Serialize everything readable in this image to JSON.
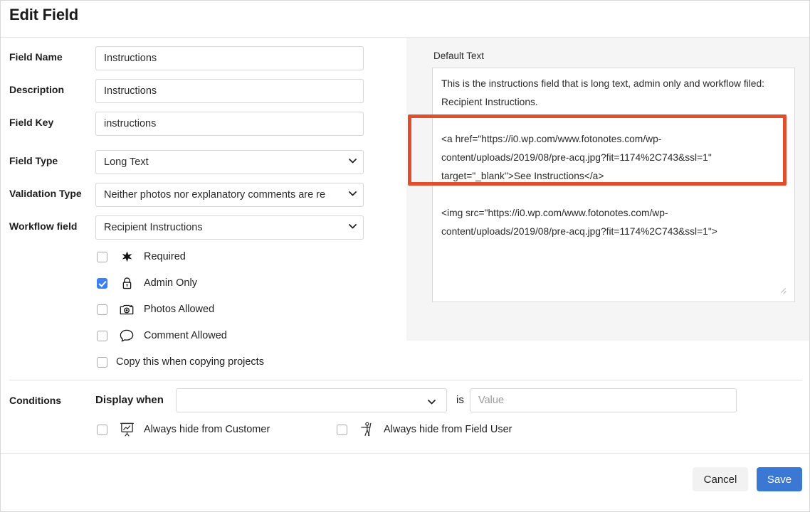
{
  "header": {
    "title": "Edit Field"
  },
  "form": {
    "rows": [
      {
        "label": "Field Name",
        "value": "Instructions",
        "control": "text"
      },
      {
        "label": "Description",
        "value": "Instructions",
        "control": "text"
      },
      {
        "label": "Field Key",
        "value": "instructions",
        "control": "text"
      },
      {
        "label": "Field Type",
        "value": "Long Text",
        "control": "select"
      },
      {
        "label": "Validation Type",
        "value": "Neither photos nor explanatory comments are re",
        "control": "select"
      },
      {
        "label": "Workflow field",
        "value": "Recipient Instructions",
        "control": "select"
      }
    ],
    "checkboxes": [
      {
        "label": "Required",
        "icon": "star-icon",
        "checked": false
      },
      {
        "label": "Admin Only",
        "icon": "lock-icon",
        "checked": true
      },
      {
        "label": "Photos Allowed",
        "icon": "camera-icon",
        "checked": false
      },
      {
        "label": "Comment Allowed",
        "icon": "comment-icon",
        "checked": false
      },
      {
        "label": "Copy this when copying projects",
        "icon": "none",
        "checked": false
      }
    ]
  },
  "default_text": {
    "label": "Default Text",
    "value": "This is the instructions field that is long text, admin only and workflow filed: Recipient Instructions.\n\n<a href=\"https://i0.wp.com/www.fotonotes.com/wp-content/uploads/2019/08/pre-acq.jpg?fit=1174%2C743&ssl=1\" target=\"_blank\">See Instructions</a>\n\n<img src=\"https://i0.wp.com/www.fotonotes.com/wp-content/uploads/2019/08/pre-acq.jpg?fit=1174%2C743&ssl=1\">"
  },
  "annotation": {
    "color": "#e04f2c"
  },
  "conditions": {
    "label": "Conditions",
    "display_when_label": "Display when",
    "display_when_value": "",
    "is_label": "is",
    "value_placeholder": "Value",
    "value_current": "",
    "checkboxes": [
      {
        "label": "Always hide from Customer",
        "icon": "presentation-chart-icon",
        "checked": false
      },
      {
        "label": "Always hide from Field User",
        "icon": "field-worker-icon",
        "checked": false
      }
    ]
  },
  "footer": {
    "cancel_label": "Cancel",
    "save_label": "Save",
    "save_color": "#3a78d4"
  }
}
